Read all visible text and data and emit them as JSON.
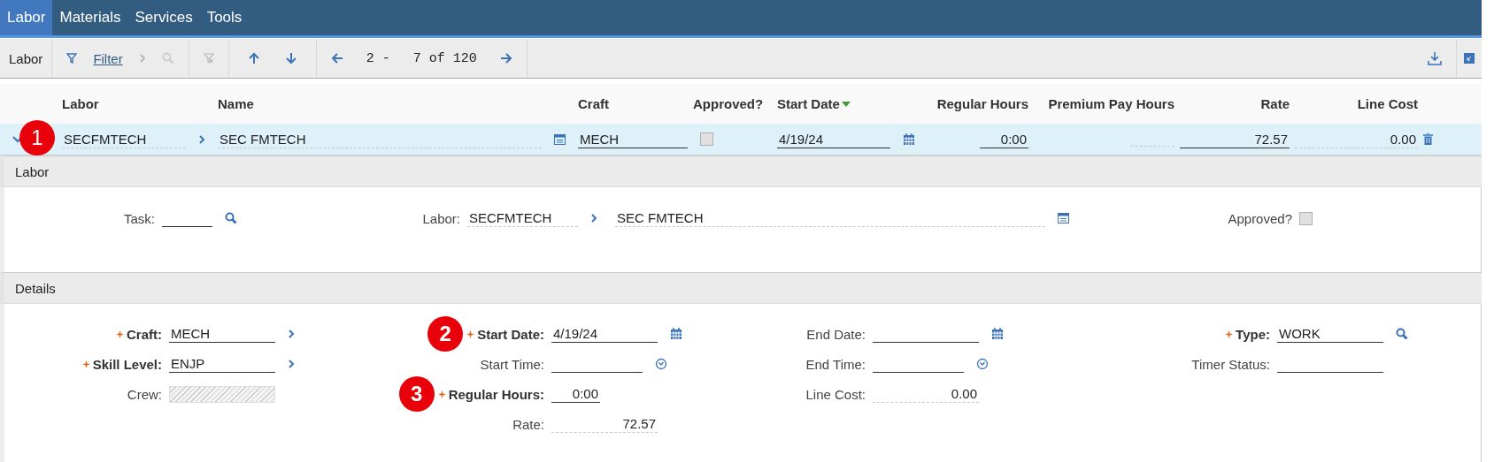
{
  "nav_tabs": [
    {
      "label": "Labor",
      "selected": true
    },
    {
      "label": "Materials",
      "selected": false
    },
    {
      "label": "Services",
      "selected": false
    },
    {
      "label": "Tools",
      "selected": false
    }
  ],
  "toolbar": {
    "title": "Labor",
    "filter": "Filter",
    "range_start": "2 -",
    "range_end": "7 of 120"
  },
  "table": {
    "columns": [
      {
        "label": "Labor",
        "kind": "link",
        "sorted": false
      },
      {
        "label": "Name",
        "kind": "long",
        "sorted": false
      },
      {
        "label": "Craft",
        "kind": "text",
        "sorted": false
      },
      {
        "label": "Approved?",
        "kind": "checkbox",
        "sorted": false
      },
      {
        "label": "Start Date",
        "kind": "date",
        "sorted": true
      },
      {
        "label": "Regular Hours",
        "kind": "number",
        "sorted": false
      },
      {
        "label": "Premium Pay Hours",
        "kind": "number",
        "sorted": false
      },
      {
        "label": "Rate",
        "kind": "number",
        "sorted": false
      },
      {
        "label": "Line Cost",
        "kind": "number",
        "sorted": false
      }
    ],
    "rows": [
      {
        "expanded": true,
        "callout": "1",
        "cells": [
          {
            "value": "SECFMTECH",
            "readonly": true
          },
          {
            "value": "SEC FMTECH",
            "readonly": true
          },
          {
            "value": "MECH",
            "readonly": false
          },
          {
            "checked": false
          },
          {
            "value": "4/19/24",
            "readonly": false
          },
          {
            "value": "0:00",
            "readonly": false
          },
          {
            "readonly": true
          },
          {
            "value": "72.57",
            "readonly": false
          },
          {
            "value": "0.00",
            "readonly": true
          }
        ]
      }
    ]
  },
  "labor_section": {
    "title": "Labor",
    "fields": [
      {
        "label": "Task:",
        "kind": "lookup",
        "readonly": false
      },
      {
        "label": "Labor:",
        "value": "SECFMTECH",
        "kind": "link",
        "readonly": true
      },
      {
        "value": "SEC FMTECH",
        "kind": "long",
        "readonly": true
      },
      {
        "label": "Approved?",
        "kind": "checkbox",
        "checked": false
      }
    ]
  },
  "details_section": {
    "title": "Details",
    "columns": [
      [
        {
          "label": "Craft:",
          "value": "MECH",
          "kind": "link",
          "readonly": false,
          "required": true
        },
        {
          "label": "Skill Level:",
          "value": "ENJP",
          "kind": "link",
          "readonly": false,
          "required": true
        },
        {
          "label": "Crew:",
          "kind": "text",
          "disabled": true,
          "readonly": false,
          "required": false
        }
      ],
      [
        {
          "label": "Start Date:",
          "value": "4/19/24",
          "kind": "date",
          "readonly": false,
          "required": true,
          "callout": "2"
        },
        {
          "label": "Start Time:",
          "kind": "time",
          "readonly": false,
          "required": false
        },
        {
          "label": "Regular Hours:",
          "value": "0:00",
          "kind": "number",
          "readonly": false,
          "required": true,
          "callout": "3"
        },
        {
          "label": "Rate:",
          "value": "72.57",
          "kind": "number",
          "readonly": true,
          "required": false
        }
      ],
      [
        {
          "label": "End Date:",
          "kind": "date",
          "readonly": false,
          "required": false
        },
        {
          "label": "End Time:",
          "kind": "time",
          "readonly": false,
          "required": false
        },
        {
          "label": "Line Cost:",
          "value": "0.00",
          "kind": "number",
          "readonly": true,
          "required": false
        }
      ],
      [
        {
          "label": "Type:",
          "value": "WORK",
          "kind": "lookup",
          "readonly": false,
          "required": true
        },
        {
          "label": "Timer Status:",
          "kind": "text",
          "readonly": false,
          "required": false
        }
      ]
    ]
  }
}
